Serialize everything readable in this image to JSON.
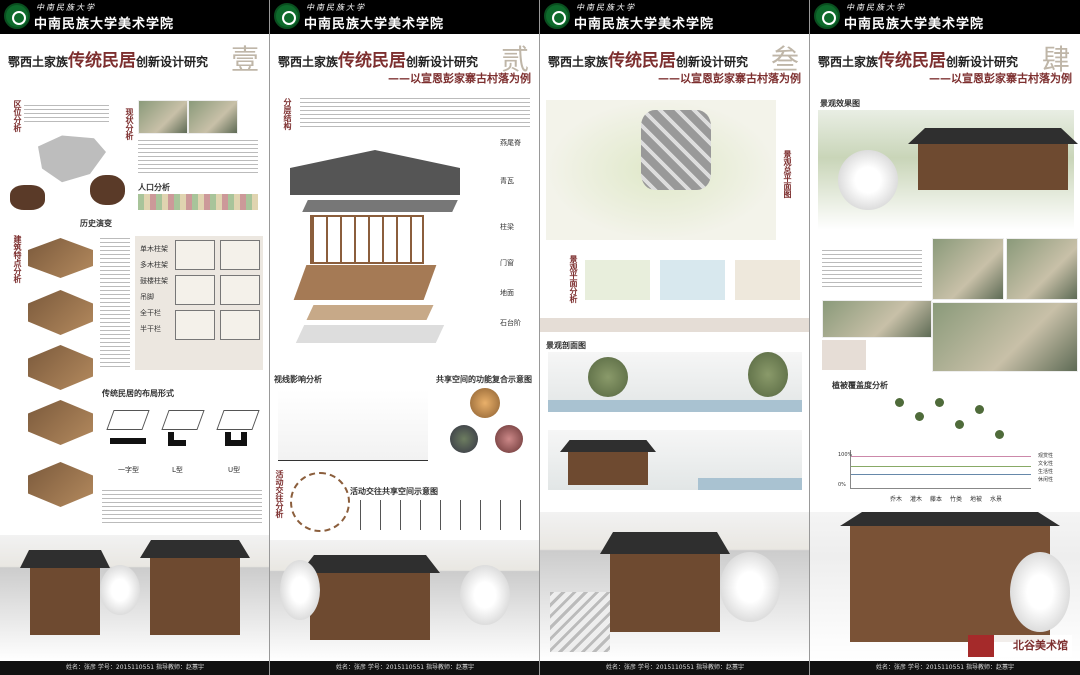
{
  "school": "中南民族大学美术学院",
  "title_pre": "鄂西土家族",
  "title_big": "传统民居",
  "title_post": "创新设计研究",
  "subtitle": "——以宣恩彭家寨古村落为例",
  "numerals": [
    "壹",
    "贰",
    "叁",
    "肆"
  ],
  "footer": "姓名：张彦 学号：2015110551 指导教师：赵蕙宇",
  "panel1": {
    "labels": {
      "region": "区位分析",
      "status": "现状分析",
      "population": "人口分析",
      "history": "历史演变",
      "arch": "建筑特点分析",
      "layout": "传统民居的布局形式",
      "types": [
        "一字型",
        "L型",
        "U型"
      ],
      "structs": [
        "单木柱架",
        "多木柱架",
        "鼓楼柱架",
        "吊脚",
        "全干栏",
        "半干栏"
      ]
    }
  },
  "panel2": {
    "labels": {
      "structure": "分层结构",
      "layers": [
        "燕尾脊",
        "青瓦",
        "柱梁",
        "门窗",
        "地面",
        "石台阶"
      ],
      "sight": "视线影响分析",
      "shared": "共享空间的功能复合示意图",
      "activity": "活动交往共享空间示意图",
      "activity_side": "活动交往分析"
    }
  },
  "panel3": {
    "labels": {
      "plan": "景观总平面图",
      "plan_analysis": "景观平面分析",
      "section": "景观剖面图"
    }
  },
  "panel4": {
    "labels": {
      "effect": "景观效果图",
      "plant": "植被覆盖度分析",
      "yaxis": [
        "100%",
        "80%",
        "60%",
        "40%",
        "20%",
        "0%"
      ],
      "categories": [
        "乔木",
        "灌木",
        "藤本",
        "竹类",
        "地被",
        "水景"
      ],
      "legend": [
        "观赏性",
        "文化性",
        "生活性",
        "休闲性"
      ],
      "museum": "北谷美术馆"
    }
  }
}
